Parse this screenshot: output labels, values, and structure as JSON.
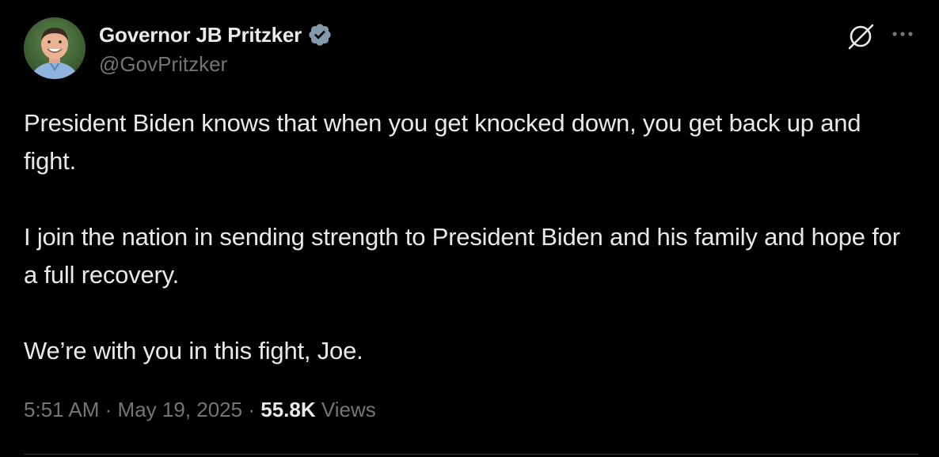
{
  "author": {
    "display_name": "Governor JB Pritzker",
    "handle": "@GovPritzker",
    "verified_badge": "verified-badge-icon",
    "badge_color": "#71767b"
  },
  "actions": {
    "grok_icon": "grok-icon",
    "more_icon": "more-options-icon",
    "more_label": "···"
  },
  "tweet": {
    "paragraphs": [
      "President Biden knows that when you get knocked down, you get back up and fight.",
      "I join the nation in sending strength to President Biden and his family and hope for a full recovery.",
      "We’re with you in this fight, Joe."
    ]
  },
  "meta": {
    "time": "5:51 AM",
    "separator": "·",
    "date": "May 19, 2025",
    "views_count": "55.8K",
    "views_label": "Views"
  },
  "colors": {
    "background": "#000000",
    "text_primary": "#e7e9ea",
    "text_secondary": "#71767b",
    "divider": "#2f3336"
  }
}
